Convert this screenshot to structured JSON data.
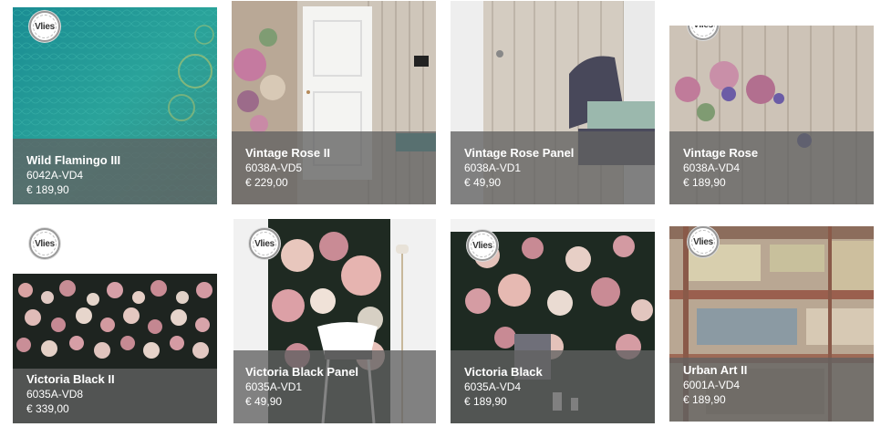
{
  "badge_text": "Vlies",
  "products": [
    {
      "title": "Wild Flamingo III",
      "code": "6042A-VD4",
      "price": "€ 189,90"
    },
    {
      "title": "Vintage Rose II",
      "code": "6038A-VD5",
      "price": "€ 229,00"
    },
    {
      "title": "Vintage Rose Panel",
      "code": "6038A-VD1",
      "price": "€ 49,90"
    },
    {
      "title": "Vintage Rose",
      "code": "6038A-VD4",
      "price": "€ 189,90"
    },
    {
      "title": "Victoria Black II",
      "code": "6035A-VD8",
      "price": "€ 339,00"
    },
    {
      "title": "Victoria Black Panel",
      "code": "6035A-VD1",
      "price": "€ 49,90"
    },
    {
      "title": "Victoria Black",
      "code": "6035A-VD4",
      "price": "€ 189,90"
    },
    {
      "title": "Urban Art II",
      "code": "6001A-VD4",
      "price": "€ 189,90"
    }
  ]
}
